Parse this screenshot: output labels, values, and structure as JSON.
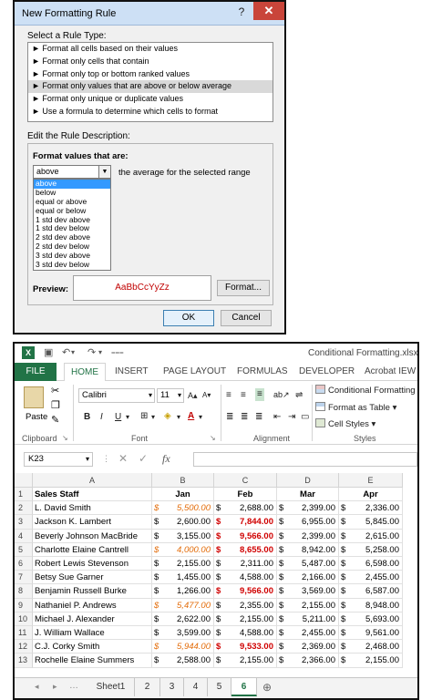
{
  "dialog": {
    "title": "New Formatting Rule",
    "help_glyph": "?",
    "close_glyph": "✕",
    "select_type_label": "Select a Rule Type:",
    "rule_types": [
      {
        "label": "► Format all cells based on their values",
        "selected": false
      },
      {
        "label": "► Format only cells that contain",
        "selected": false
      },
      {
        "label": "► Format only top or bottom ranked values",
        "selected": false
      },
      {
        "label": "► Format only values that are above or below average",
        "selected": true
      },
      {
        "label": "► Format only unique or duplicate values",
        "selected": false
      },
      {
        "label": "► Use a formula to determine which cells to format",
        "selected": false
      }
    ],
    "edit_desc_label": "Edit the Rule Description:",
    "format_values_label": "Format values that are:",
    "combo_value": "above",
    "combo_suffix": "the average for the selected range",
    "dropdown_options": [
      {
        "label": "above",
        "selected": true
      },
      {
        "label": "below",
        "selected": false
      },
      {
        "label": "equal or above",
        "selected": false
      },
      {
        "label": "equal or below",
        "selected": false
      },
      {
        "label": "1 std dev above",
        "selected": false
      },
      {
        "label": "1 std dev below",
        "selected": false
      },
      {
        "label": "2 std dev above",
        "selected": false
      },
      {
        "label": "2 std dev below",
        "selected": false
      },
      {
        "label": "3 std dev above",
        "selected": false
      },
      {
        "label": "3 std dev below",
        "selected": false
      }
    ],
    "preview_label": "Preview:",
    "preview_text": "AaBbCcYyZz",
    "format_button": "Format...",
    "ok_button": "OK",
    "cancel_button": "Cancel"
  },
  "excel": {
    "app_icon_label": "X",
    "window_title": "Conditional Formatting.xlsx -",
    "ribbon_tabs": [
      "FILE",
      "HOME",
      "INSERT",
      "PAGE LAYOUT",
      "FORMULAS",
      "DEVELOPER",
      "Acrobat IEW"
    ],
    "clipboard": {
      "paste_label": "Paste",
      "group_label": "Clipboard"
    },
    "font": {
      "name": "Calibri",
      "size": "11",
      "group_label": "Font",
      "bold": "B",
      "italic": "I",
      "underline": "U"
    },
    "alignment": {
      "group_label": "Alignment"
    },
    "styles": {
      "conditional_formatting": "Conditional Formatting",
      "format_as_table": "Format as Table",
      "cell_styles": "Cell Styles",
      "group_label": "Styles"
    },
    "name_box": "K23",
    "fx_label": "fx",
    "columns": [
      "A",
      "B",
      "C",
      "D",
      "E"
    ],
    "rows": [
      {
        "num": "1",
        "name": "Sales Staff",
        "cells": [
          {
            "cur": "",
            "amt": "Jan",
            "style": "hdr"
          },
          {
            "cur": "",
            "amt": "Feb",
            "style": "hdr"
          },
          {
            "cur": "",
            "amt": "Mar",
            "style": "hdr"
          },
          {
            "cur": "",
            "amt": "Apr",
            "style": "hdr"
          }
        ]
      },
      {
        "num": "2",
        "name": "L. David Smith",
        "cells": [
          {
            "cur": "$",
            "amt": "5,500.00",
            "style": "orange"
          },
          {
            "cur": "$",
            "amt": "2,688.00",
            "style": ""
          },
          {
            "cur": "$",
            "amt": "2,399.00",
            "style": ""
          },
          {
            "cur": "$",
            "amt": "2,336.00",
            "style": ""
          }
        ]
      },
      {
        "num": "3",
        "name": "Jackson K. Lambert",
        "cells": [
          {
            "cur": "$",
            "amt": "2,600.00",
            "style": ""
          },
          {
            "cur": "$",
            "amt": "7,844.00",
            "style": "red"
          },
          {
            "cur": "$",
            "amt": "6,955.00",
            "style": ""
          },
          {
            "cur": "$",
            "amt": "5,845.00",
            "style": ""
          }
        ]
      },
      {
        "num": "4",
        "name": "Beverly Johnson MacBride",
        "cells": [
          {
            "cur": "$",
            "amt": "3,155.00",
            "style": ""
          },
          {
            "cur": "$",
            "amt": "9,566.00",
            "style": "red"
          },
          {
            "cur": "$",
            "amt": "2,399.00",
            "style": ""
          },
          {
            "cur": "$",
            "amt": "2,615.00",
            "style": ""
          }
        ]
      },
      {
        "num": "5",
        "name": "Charlotte Elaine Cantrell",
        "cells": [
          {
            "cur": "$",
            "amt": "4,000.00",
            "style": "orange"
          },
          {
            "cur": "$",
            "amt": "8,655.00",
            "style": "red"
          },
          {
            "cur": "$",
            "amt": "8,942.00",
            "style": ""
          },
          {
            "cur": "$",
            "amt": "5,258.00",
            "style": ""
          }
        ]
      },
      {
        "num": "6",
        "name": "Robert Lewis Stevenson",
        "cells": [
          {
            "cur": "$",
            "amt": "2,155.00",
            "style": ""
          },
          {
            "cur": "$",
            "amt": "2,311.00",
            "style": ""
          },
          {
            "cur": "$",
            "amt": "5,487.00",
            "style": ""
          },
          {
            "cur": "$",
            "amt": "6,598.00",
            "style": ""
          }
        ]
      },
      {
        "num": "7",
        "name": "Betsy Sue Garner",
        "cells": [
          {
            "cur": "$",
            "amt": "1,455.00",
            "style": ""
          },
          {
            "cur": "$",
            "amt": "4,588.00",
            "style": ""
          },
          {
            "cur": "$",
            "amt": "2,166.00",
            "style": ""
          },
          {
            "cur": "$",
            "amt": "2,455.00",
            "style": ""
          }
        ]
      },
      {
        "num": "8",
        "name": "Benjamin Russell Burke",
        "cells": [
          {
            "cur": "$",
            "amt": "1,266.00",
            "style": ""
          },
          {
            "cur": "$",
            "amt": "9,566.00",
            "style": "red"
          },
          {
            "cur": "$",
            "amt": "3,569.00",
            "style": ""
          },
          {
            "cur": "$",
            "amt": "6,587.00",
            "style": ""
          }
        ]
      },
      {
        "num": "9",
        "name": "Nathaniel P. Andrews",
        "cells": [
          {
            "cur": "$",
            "amt": "5,477.00",
            "style": "orange"
          },
          {
            "cur": "$",
            "amt": "2,355.00",
            "style": ""
          },
          {
            "cur": "$",
            "amt": "2,155.00",
            "style": ""
          },
          {
            "cur": "$",
            "amt": "8,948.00",
            "style": ""
          }
        ]
      },
      {
        "num": "10",
        "name": "Michael J. Alexander",
        "cells": [
          {
            "cur": "$",
            "amt": "2,622.00",
            "style": ""
          },
          {
            "cur": "$",
            "amt": "2,155.00",
            "style": ""
          },
          {
            "cur": "$",
            "amt": "5,211.00",
            "style": ""
          },
          {
            "cur": "$",
            "amt": "5,693.00",
            "style": ""
          }
        ]
      },
      {
        "num": "11",
        "name": "J. William Wallace",
        "cells": [
          {
            "cur": "$",
            "amt": "3,599.00",
            "style": ""
          },
          {
            "cur": "$",
            "amt": "4,588.00",
            "style": ""
          },
          {
            "cur": "$",
            "amt": "2,455.00",
            "style": ""
          },
          {
            "cur": "$",
            "amt": "9,561.00",
            "style": ""
          }
        ]
      },
      {
        "num": "12",
        "name": "C.J. Corky Smith",
        "cells": [
          {
            "cur": "$",
            "amt": "5,944.00",
            "style": "orange"
          },
          {
            "cur": "$",
            "amt": "9,533.00",
            "style": "red"
          },
          {
            "cur": "$",
            "amt": "2,369.00",
            "style": ""
          },
          {
            "cur": "$",
            "amt": "2,468.00",
            "style": ""
          }
        ]
      },
      {
        "num": "13",
        "name": "Rochelle Elaine Summers",
        "cells": [
          {
            "cur": "$",
            "amt": "2,588.00",
            "style": ""
          },
          {
            "cur": "$",
            "amt": "2,155.00",
            "style": ""
          },
          {
            "cur": "$",
            "amt": "2,366.00",
            "style": ""
          },
          {
            "cur": "$",
            "amt": "2,155.00",
            "style": ""
          }
        ]
      }
    ],
    "sheet_tabs": [
      {
        "label": "Sheet1",
        "active": false
      },
      {
        "label": "2",
        "active": false
      },
      {
        "label": "3",
        "active": false
      },
      {
        "label": "4",
        "active": false
      },
      {
        "label": "5",
        "active": false
      },
      {
        "label": "6",
        "active": true
      }
    ],
    "colors": {
      "excel_green": "#217346",
      "above_avg_orange": "#e36c09",
      "above_avg_red": "#d00000"
    }
  }
}
